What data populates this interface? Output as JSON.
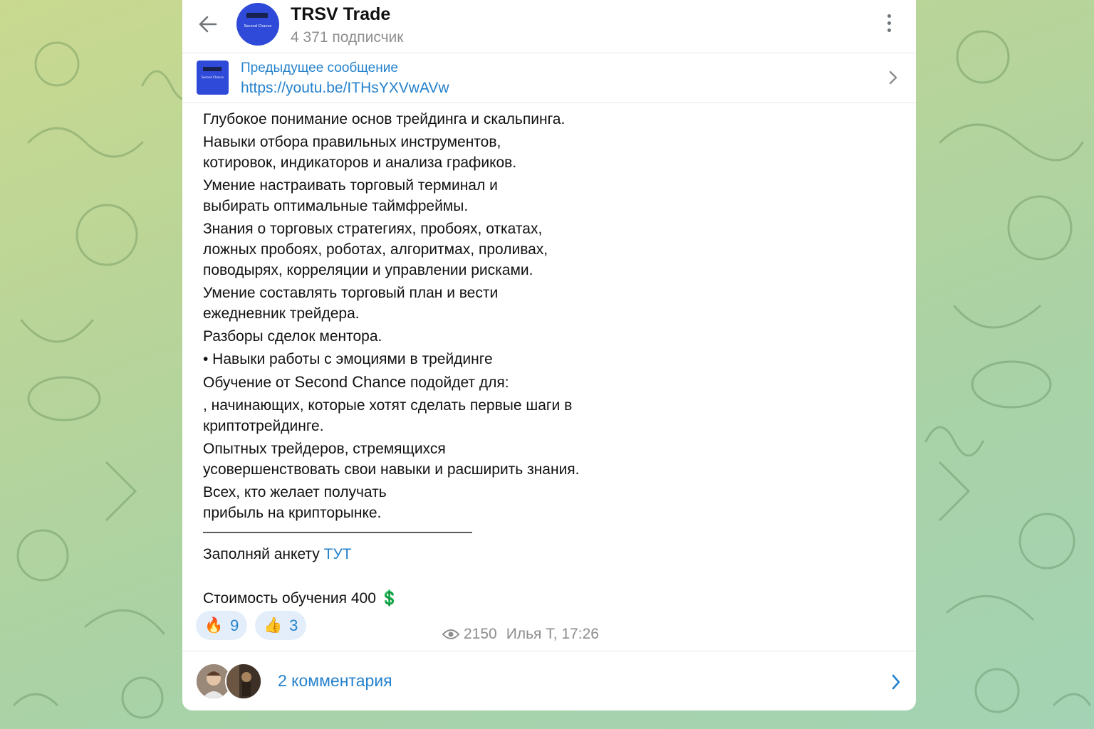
{
  "colors": {
    "accent": "#2481cc",
    "avatar_blue": "#2f4ad8",
    "reaction_bg": "#e4eefa",
    "muted_text": "#8d8d8d"
  },
  "header": {
    "back_icon": "arrow-left-icon",
    "avatar_text": "Second Chance",
    "title": "TRSV Trade",
    "subscribers": "4 371 подписчик",
    "menu_icon": "more-vertical-icon"
  },
  "pinned": {
    "title": "Предыдущее сообщение",
    "link": "https://youtu.be/ITHsYXVwAVw",
    "thumb_text": "Second Chance",
    "chevron_icon": "chevron-right-icon"
  },
  "message": {
    "l1": "Глубокое понимание основ трейдинга и скальпинга.",
    "l2a": "Навыки отбора правильных инструментов,",
    "l2b": "котировок, индикаторов и анализа графиков.",
    "l3a": "Умение настраивать торговый терминал и",
    "l3b": "выбирать оптимальные таймфреймы.",
    "l4a": "Знания о торговых стратегиях, пробоях, откатах,",
    "l4b": "ложных пробоях, роботах, алгоритмах, проливах,",
    "l4c": "поводырях, корреляции и управлении рисками.",
    "l5a": "Умение составлять торговый план и вести",
    "l5b": "ежедневник трейдера.",
    "l6": "Разборы сделок ментора.",
    "l7": "• Навыки работы с эмоциями в трейдинге",
    "l8_pre": "Обучение от ",
    "l8_brand": "Second Chance",
    "l8_post": " подойдет для:",
    "l9a": ", начинающих, которые хотят сделать первые шаги в",
    "l9b": "криптотрейдинге.",
    "l10a": "Опытных трейдеров, стремящихся",
    "l10b": "усовершенствовать свои навыки и расширить знания.",
    "l11a": "Всех, кто желает получать",
    "l11b": "прибыль на крипторынке.",
    "divider": "——————————————————",
    "form_pre": "Заполняй анкету ",
    "form_link": "ТУТ",
    "price": "Стоимость обучения 400 💲"
  },
  "reactions": [
    {
      "emoji": "🔥",
      "count": "9",
      "icon": "fire-icon"
    },
    {
      "emoji": "👍",
      "count": "3",
      "icon": "thumbs-up-icon"
    }
  ],
  "meta": {
    "views_icon": "eye-icon",
    "views": "2150",
    "author_time": "Илья Т, 17:26"
  },
  "comments": {
    "label": "2 комментария",
    "chevron_icon": "chevron-right-icon"
  }
}
